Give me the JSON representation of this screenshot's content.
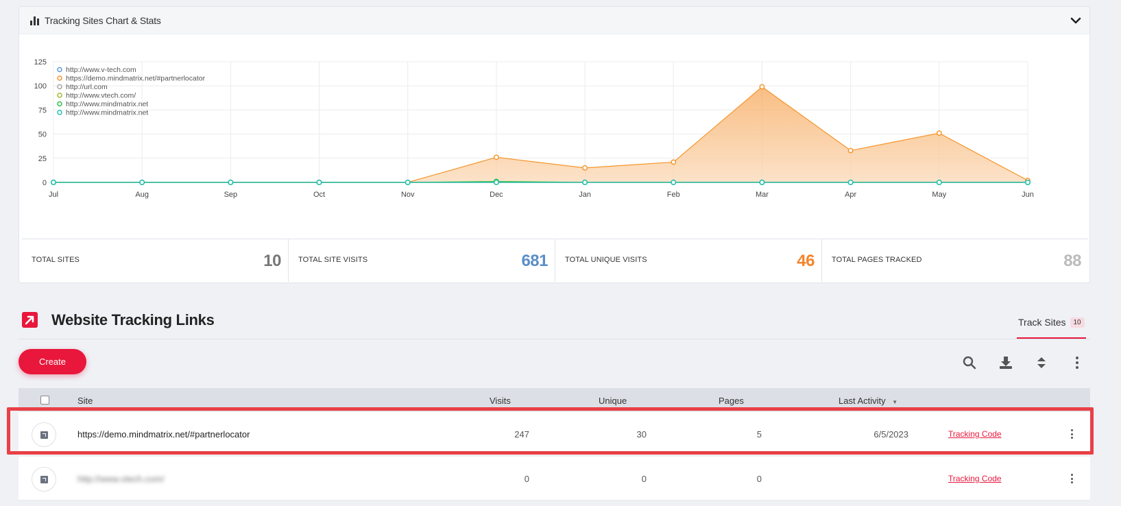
{
  "chart_panel": {
    "title": "Tracking Sites Chart & Stats",
    "icon": "bar-chart-icon"
  },
  "chart_data": {
    "type": "line",
    "categories": [
      "Jul",
      "Aug",
      "Sep",
      "Oct",
      "Nov",
      "Dec",
      "Jan",
      "Feb",
      "Mar",
      "Apr",
      "May",
      "Jun"
    ],
    "ylim": [
      0,
      125
    ],
    "yticks": [
      0,
      25,
      50,
      75,
      100,
      125
    ],
    "grid": true,
    "legend_position": "top-left",
    "series": [
      {
        "name": "http://www.v-tech.com",
        "color": "#5b9bd5",
        "values": [
          0,
          0,
          0,
          0,
          0,
          0,
          0,
          0,
          0,
          0,
          0,
          0
        ],
        "fill": false
      },
      {
        "name": "https://demo.mindmatrix.net/#partnerlocator",
        "color": "#f5962b",
        "values": [
          0,
          0,
          0,
          0,
          0,
          26,
          15,
          21,
          99,
          33,
          51,
          2
        ],
        "fill": true
      },
      {
        "name": "http://url.com",
        "color": "#a5a5a5",
        "values": [
          0,
          0,
          0,
          0,
          0,
          0,
          0,
          0,
          0,
          0,
          0,
          0
        ],
        "fill": false
      },
      {
        "name": "http://www.vtech.com/",
        "color": "#9bbb2e",
        "values": [
          0,
          0,
          0,
          0,
          0,
          0,
          0,
          0,
          0,
          0,
          0,
          0
        ],
        "fill": false
      },
      {
        "name": "http://www.mindmatrix.net",
        "color": "#2fbf4a",
        "values": [
          0,
          0,
          0,
          0,
          0,
          1,
          0,
          0,
          0,
          0,
          0,
          0
        ],
        "fill": false
      },
      {
        "name": "http://www.mindmatrix.net",
        "color": "#21c0b5",
        "values": [
          0,
          0,
          0,
          0,
          0,
          0,
          0,
          0,
          0,
          0,
          0,
          0
        ],
        "fill": false
      }
    ]
  },
  "stats": [
    {
      "label": "TOTAL SITES",
      "value": "10",
      "color": "#777777"
    },
    {
      "label": "TOTAL SITE VISITS",
      "value": "681",
      "color": "#5b8ec7"
    },
    {
      "label": "TOTAL UNIQUE VISITS",
      "value": "46",
      "color": "#f5842b"
    },
    {
      "label": "TOTAL PAGES TRACKED",
      "value": "88",
      "color": "#bbbbbb"
    }
  ],
  "section": {
    "title": "Website Tracking Links",
    "tab_label": "Track Sites",
    "tab_count": "10",
    "create_label": "Create"
  },
  "toolbar": {
    "icons": [
      "search-icon",
      "download-icon",
      "sort-icon",
      "more-icon"
    ]
  },
  "table": {
    "columns": [
      "Site",
      "Visits",
      "Unique",
      "Pages",
      "Last Activity"
    ],
    "sort_indicator": "▼",
    "rows": [
      {
        "site": "https://demo.mindmatrix.net/#partnerlocator",
        "visits": "247",
        "unique": "30",
        "pages": "5",
        "last_activity": "6/5/2023",
        "action": "Tracking Code"
      },
      {
        "site": "http://www.vtech.com/",
        "visits": "0",
        "unique": "0",
        "pages": "0",
        "last_activity": "",
        "action": "Tracking Code"
      }
    ]
  },
  "accent_color": "#e8173b"
}
